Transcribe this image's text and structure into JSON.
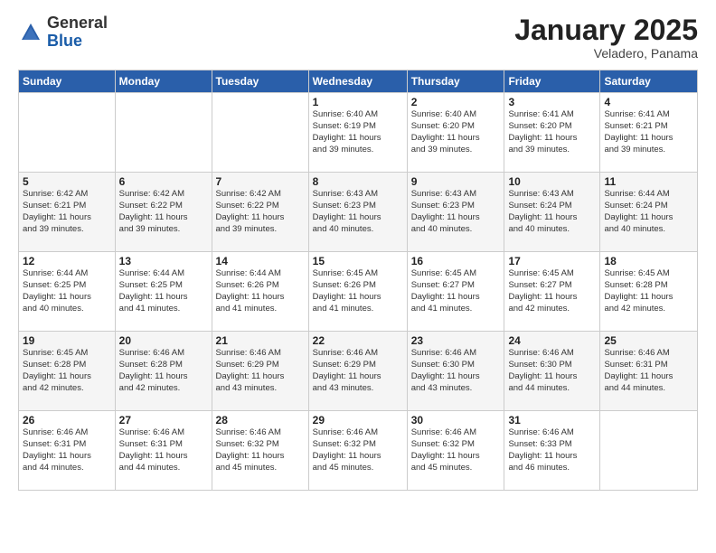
{
  "header": {
    "logo_general": "General",
    "logo_blue": "Blue",
    "month_title": "January 2025",
    "location": "Veladero, Panama"
  },
  "weekdays": [
    "Sunday",
    "Monday",
    "Tuesday",
    "Wednesday",
    "Thursday",
    "Friday",
    "Saturday"
  ],
  "weeks": [
    [
      {
        "day": "",
        "info": ""
      },
      {
        "day": "",
        "info": ""
      },
      {
        "day": "",
        "info": ""
      },
      {
        "day": "1",
        "info": "Sunrise: 6:40 AM\nSunset: 6:19 PM\nDaylight: 11 hours\nand 39 minutes."
      },
      {
        "day": "2",
        "info": "Sunrise: 6:40 AM\nSunset: 6:20 PM\nDaylight: 11 hours\nand 39 minutes."
      },
      {
        "day": "3",
        "info": "Sunrise: 6:41 AM\nSunset: 6:20 PM\nDaylight: 11 hours\nand 39 minutes."
      },
      {
        "day": "4",
        "info": "Sunrise: 6:41 AM\nSunset: 6:21 PM\nDaylight: 11 hours\nand 39 minutes."
      }
    ],
    [
      {
        "day": "5",
        "info": "Sunrise: 6:42 AM\nSunset: 6:21 PM\nDaylight: 11 hours\nand 39 minutes."
      },
      {
        "day": "6",
        "info": "Sunrise: 6:42 AM\nSunset: 6:22 PM\nDaylight: 11 hours\nand 39 minutes."
      },
      {
        "day": "7",
        "info": "Sunrise: 6:42 AM\nSunset: 6:22 PM\nDaylight: 11 hours\nand 39 minutes."
      },
      {
        "day": "8",
        "info": "Sunrise: 6:43 AM\nSunset: 6:23 PM\nDaylight: 11 hours\nand 40 minutes."
      },
      {
        "day": "9",
        "info": "Sunrise: 6:43 AM\nSunset: 6:23 PM\nDaylight: 11 hours\nand 40 minutes."
      },
      {
        "day": "10",
        "info": "Sunrise: 6:43 AM\nSunset: 6:24 PM\nDaylight: 11 hours\nand 40 minutes."
      },
      {
        "day": "11",
        "info": "Sunrise: 6:44 AM\nSunset: 6:24 PM\nDaylight: 11 hours\nand 40 minutes."
      }
    ],
    [
      {
        "day": "12",
        "info": "Sunrise: 6:44 AM\nSunset: 6:25 PM\nDaylight: 11 hours\nand 40 minutes."
      },
      {
        "day": "13",
        "info": "Sunrise: 6:44 AM\nSunset: 6:25 PM\nDaylight: 11 hours\nand 41 minutes."
      },
      {
        "day": "14",
        "info": "Sunrise: 6:44 AM\nSunset: 6:26 PM\nDaylight: 11 hours\nand 41 minutes."
      },
      {
        "day": "15",
        "info": "Sunrise: 6:45 AM\nSunset: 6:26 PM\nDaylight: 11 hours\nand 41 minutes."
      },
      {
        "day": "16",
        "info": "Sunrise: 6:45 AM\nSunset: 6:27 PM\nDaylight: 11 hours\nand 41 minutes."
      },
      {
        "day": "17",
        "info": "Sunrise: 6:45 AM\nSunset: 6:27 PM\nDaylight: 11 hours\nand 42 minutes."
      },
      {
        "day": "18",
        "info": "Sunrise: 6:45 AM\nSunset: 6:28 PM\nDaylight: 11 hours\nand 42 minutes."
      }
    ],
    [
      {
        "day": "19",
        "info": "Sunrise: 6:45 AM\nSunset: 6:28 PM\nDaylight: 11 hours\nand 42 minutes."
      },
      {
        "day": "20",
        "info": "Sunrise: 6:46 AM\nSunset: 6:28 PM\nDaylight: 11 hours\nand 42 minutes."
      },
      {
        "day": "21",
        "info": "Sunrise: 6:46 AM\nSunset: 6:29 PM\nDaylight: 11 hours\nand 43 minutes."
      },
      {
        "day": "22",
        "info": "Sunrise: 6:46 AM\nSunset: 6:29 PM\nDaylight: 11 hours\nand 43 minutes."
      },
      {
        "day": "23",
        "info": "Sunrise: 6:46 AM\nSunset: 6:30 PM\nDaylight: 11 hours\nand 43 minutes."
      },
      {
        "day": "24",
        "info": "Sunrise: 6:46 AM\nSunset: 6:30 PM\nDaylight: 11 hours\nand 44 minutes."
      },
      {
        "day": "25",
        "info": "Sunrise: 6:46 AM\nSunset: 6:31 PM\nDaylight: 11 hours\nand 44 minutes."
      }
    ],
    [
      {
        "day": "26",
        "info": "Sunrise: 6:46 AM\nSunset: 6:31 PM\nDaylight: 11 hours\nand 44 minutes."
      },
      {
        "day": "27",
        "info": "Sunrise: 6:46 AM\nSunset: 6:31 PM\nDaylight: 11 hours\nand 44 minutes."
      },
      {
        "day": "28",
        "info": "Sunrise: 6:46 AM\nSunset: 6:32 PM\nDaylight: 11 hours\nand 45 minutes."
      },
      {
        "day": "29",
        "info": "Sunrise: 6:46 AM\nSunset: 6:32 PM\nDaylight: 11 hours\nand 45 minutes."
      },
      {
        "day": "30",
        "info": "Sunrise: 6:46 AM\nSunset: 6:32 PM\nDaylight: 11 hours\nand 45 minutes."
      },
      {
        "day": "31",
        "info": "Sunrise: 6:46 AM\nSunset: 6:33 PM\nDaylight: 11 hours\nand 46 minutes."
      },
      {
        "day": "",
        "info": ""
      }
    ]
  ]
}
